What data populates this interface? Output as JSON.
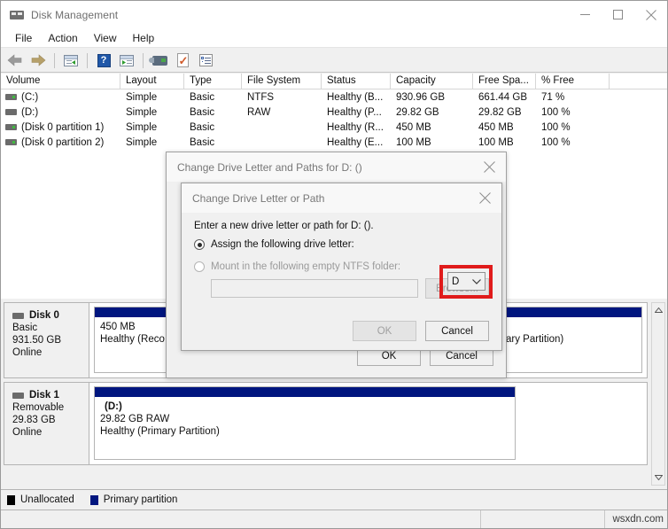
{
  "window": {
    "title": "Disk Management",
    "icon": "disk-management-icon",
    "minimize_label": "Minimize",
    "maximize_label": "Maximize",
    "close_label": "Close"
  },
  "menu": {
    "items": [
      {
        "label": "File",
        "name": "menu-file"
      },
      {
        "label": "Action",
        "name": "menu-action"
      },
      {
        "label": "View",
        "name": "menu-view"
      },
      {
        "label": "Help",
        "name": "menu-help"
      }
    ]
  },
  "toolbar": {
    "buttons": [
      {
        "icon": "back-arrow-icon",
        "label": "Back"
      },
      {
        "icon": "forward-arrow-icon",
        "label": "Forward"
      },
      {
        "icon": "show-hide-console-tree-icon",
        "label": "Show/Hide Console Tree"
      },
      {
        "icon": "help-icon",
        "label": "Help",
        "glyph": "?"
      },
      {
        "icon": "show-hide-action-pane-icon",
        "label": "Show/Hide Action Pane"
      },
      {
        "icon": "rescan-disks-icon",
        "label": "Rescan Disks"
      },
      {
        "icon": "properties-icon",
        "label": "Properties"
      },
      {
        "icon": "refresh-list-icon",
        "label": "Refresh"
      }
    ]
  },
  "volume_list": {
    "columns": [
      {
        "label": "Volume",
        "width": 135
      },
      {
        "label": "Layout",
        "width": 72
      },
      {
        "label": "Type",
        "width": 65
      },
      {
        "label": "File System",
        "width": 90
      },
      {
        "label": "Status",
        "width": 78
      },
      {
        "label": "Capacity",
        "width": 93
      },
      {
        "label": "Free Spa...",
        "width": 71
      },
      {
        "label": "% Free",
        "width": 83
      },
      {
        "label": "",
        "width": 63
      }
    ],
    "rows": [
      {
        "volume": "(C:)",
        "icon": "disk-volume-icon",
        "layout": "Simple",
        "type": "Basic",
        "file_system": "NTFS",
        "status": "Healthy (B...",
        "capacity": "930.96 GB",
        "free_space": "661.44 GB",
        "percent_free": "71 %"
      },
      {
        "volume": "(D:)",
        "icon": "disk-volume-icon-gray",
        "layout": "Simple",
        "type": "Basic",
        "file_system": "RAW",
        "status": "Healthy (P...",
        "capacity": "29.82 GB",
        "free_space": "29.82 GB",
        "percent_free": "100 %"
      },
      {
        "volume": "(Disk 0 partition 1)",
        "icon": "disk-volume-icon",
        "layout": "Simple",
        "type": "Basic",
        "file_system": "",
        "status": "Healthy (R...",
        "capacity": "450 MB",
        "free_space": "450 MB",
        "percent_free": "100 %"
      },
      {
        "volume": "(Disk 0 partition 2)",
        "icon": "disk-volume-icon",
        "layout": "Simple",
        "type": "Basic",
        "file_system": "",
        "status": "Healthy (E...",
        "capacity": "100 MB",
        "free_space": "100 MB",
        "percent_free": "100 %"
      }
    ]
  },
  "graphical_view": {
    "disks": [
      {
        "name": "Disk 0",
        "type": "Basic",
        "size": "931.50 GB",
        "state": "Online",
        "partitions": [
          {
            "label": "",
            "size": "450 MB",
            "status": "Healthy (Reco",
            "bar_color": "#00167f"
          },
          {
            "label": "",
            "size": "",
            "status": "mp, Primary Partition)",
            "bar_color": "#00167f"
          }
        ]
      },
      {
        "name": "Disk 1",
        "type": "Removable",
        "size": "29.83 GB",
        "state": "Online",
        "partitions": [
          {
            "label": "(D:)",
            "size": "29.82 GB RAW",
            "status": "Healthy (Primary Partition)",
            "bar_color": "#00167f"
          }
        ]
      }
    ],
    "scrollbar": {
      "up": "▲",
      "down": "▼"
    }
  },
  "legend": {
    "items": [
      {
        "label": "Unallocated",
        "color": "#000000"
      },
      {
        "label": "Primary partition",
        "color": "#00167f"
      }
    ]
  },
  "statusbar": {
    "watermark": "wsxdn.com"
  },
  "dialog_outer": {
    "title": "Change Drive Letter and Paths for D: ()",
    "close_label": "Close",
    "buttons": [
      {
        "label": "OK",
        "disabled": false
      },
      {
        "label": "Cancel",
        "disabled": false
      }
    ]
  },
  "dialog_inner": {
    "title": "Change Drive Letter or Path",
    "close_label": "Close",
    "prompt": "Enter a new drive letter or path for D: ().",
    "assign_option": {
      "label": "Assign the following drive letter:",
      "selected": true,
      "drive_letter": "D",
      "chevron": "⌄"
    },
    "mount_option": {
      "label": "Mount in the following empty NTFS folder:",
      "selected": false,
      "path_value": "",
      "path_placeholder": "",
      "browse_label": "Browse..."
    },
    "buttons": [
      {
        "label": "OK",
        "disabled": true
      },
      {
        "label": "Cancel",
        "disabled": false
      }
    ],
    "highlight_color": "#e01b1b"
  }
}
